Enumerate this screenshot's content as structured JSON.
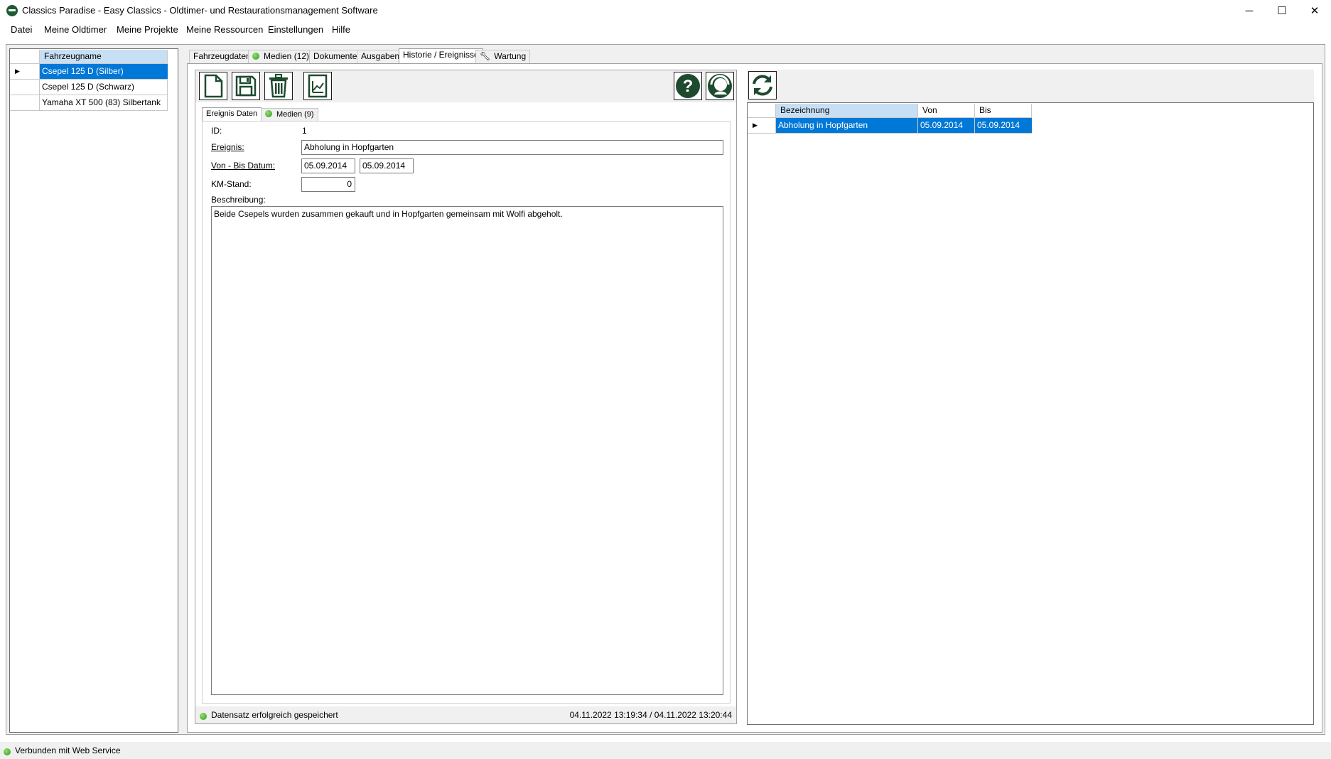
{
  "window": {
    "title": "Classics Paradise - Easy Classics - Oldtimer- und Restaurationsmanagement Software",
    "controls": {
      "minimize": "─",
      "maximize": "☐",
      "close": "✕"
    }
  },
  "menu": [
    "Datei",
    "Meine Oldtimer",
    "Meine Projekte",
    "Meine Ressourcen",
    "Einstellungen",
    "Hilfe"
  ],
  "vehicles": {
    "column": "Fahrzeugname",
    "rows": [
      "Csepel 125 D (Silber)",
      "Csepel 125 D (Schwarz)",
      "Yamaha XT 500 (83) Silbertank"
    ],
    "selected_index": 0
  },
  "tabs": [
    "Fahrzeugdaten",
    "Medien (12)",
    "Dokumente",
    "Ausgaben",
    "Historie / Ereignisse",
    "Wartung"
  ],
  "active_tab": "Historie / Ereignisse",
  "toolbar_icons": [
    "new-document-icon",
    "save-icon",
    "delete-icon",
    "report-chart-icon",
    "help-icon",
    "support-icon"
  ],
  "subtabs": [
    "Ereignis Daten",
    "Medien (9)"
  ],
  "form": {
    "id_label": "ID:",
    "id_value": "1",
    "ereignis_label": "Ereignis:",
    "ereignis_value": "Abholung in Hopfgarten",
    "datum_label": "Von - Bis Datum:",
    "von_value": "05.09.2014",
    "bis_value": "05.09.2014",
    "km_label": "KM-Stand:",
    "km_value": "0",
    "beschreibung_label": "Beschreibung:",
    "beschreibung_value": "Beide Csepels wurden zusammen gekauft und in Hopfgarten gemeinsam mit Wolfi abgeholt."
  },
  "status": {
    "message": "Datensatz erfolgreich gespeichert",
    "timestamps": "04.11.2022 13:19:34 / 04.11.2022 13:20:44"
  },
  "events_grid": {
    "columns": [
      "Bezeichnung",
      "Von",
      "Bis"
    ],
    "rows": [
      {
        "bezeichnung": "Abholung in Hopfgarten",
        "von": "05.09.2014",
        "bis": "05.09.2014"
      }
    ]
  },
  "connection_status": "Verbunden mit Web Service",
  "colors": {
    "selection": "#0078d7",
    "header": "#c7dff4",
    "icon": "#1e4a2e",
    "status_ok": "#2f9a1e"
  }
}
